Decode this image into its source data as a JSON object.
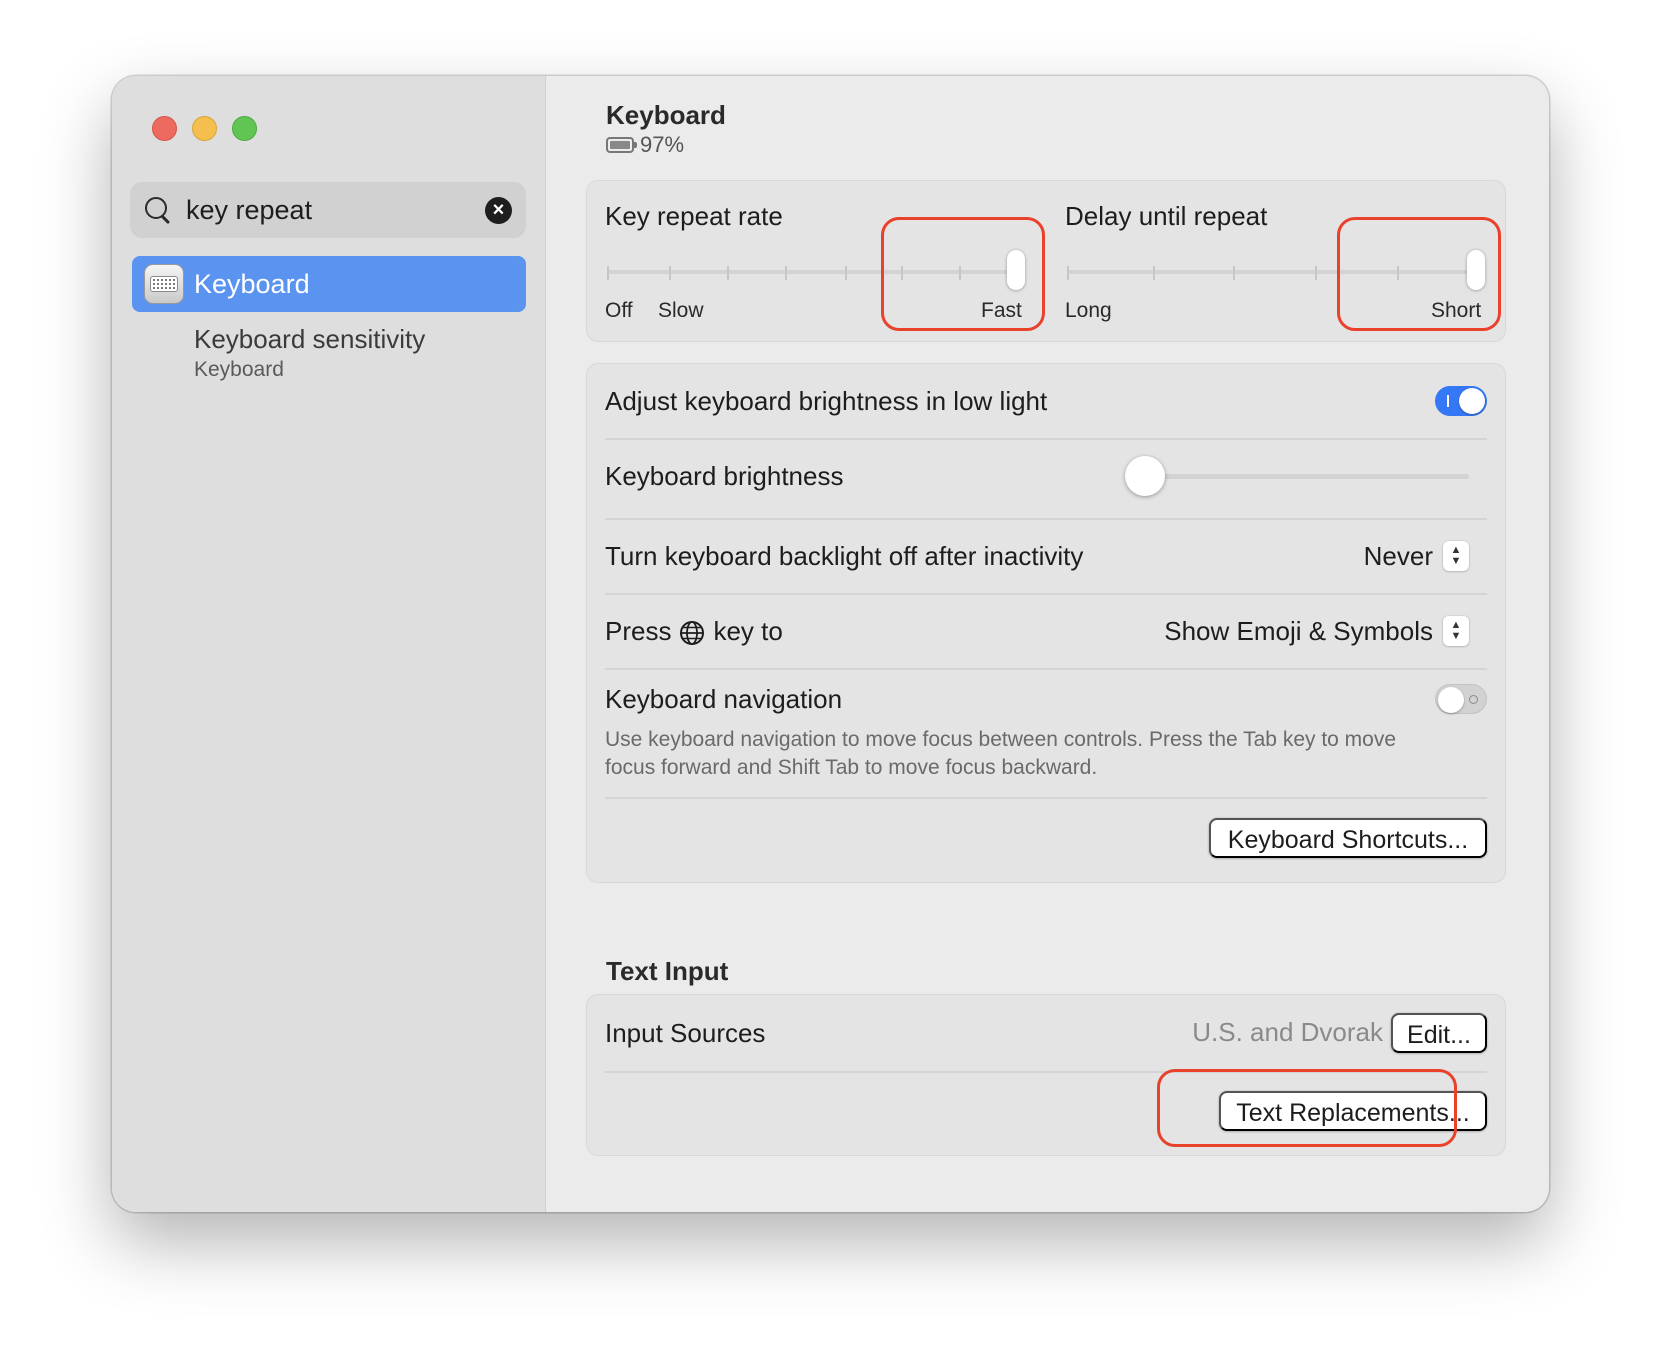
{
  "sidebar": {
    "search": {
      "value": "key repeat"
    },
    "selected_item": {
      "label": "Keyboard",
      "icon": "keyboard-icon"
    },
    "result": {
      "title": "Keyboard sensitivity",
      "subtitle": "Keyboard"
    }
  },
  "header": {
    "title": "Keyboard",
    "battery": "97%"
  },
  "key_repeat": {
    "rate": {
      "label": "Key repeat rate",
      "tick_labels": [
        "Off",
        "Slow",
        "Fast"
      ],
      "ticks": 8,
      "value_step": 7
    },
    "delay": {
      "label": "Delay until repeat",
      "tick_labels": [
        "Long",
        "Short"
      ],
      "ticks": 6,
      "value_step": 5
    }
  },
  "settings": {
    "adjust_brightness": {
      "label": "Adjust keyboard brightness in low light",
      "on": true
    },
    "brightness": {
      "label": "Keyboard brightness",
      "value": 0
    },
    "backlight_off": {
      "label": "Turn keyboard backlight off after inactivity",
      "value": "Never"
    },
    "press_key": {
      "label_before": "Press",
      "label_after": "key to",
      "value": "Show Emoji & Symbols"
    },
    "keyboard_navigation": {
      "label": "Keyboard navigation",
      "description": "Use keyboard navigation to move focus between controls. Press the Tab key to move focus forward and Shift Tab to move focus backward.",
      "on": false
    },
    "shortcuts_button": "Keyboard Shortcuts..."
  },
  "text_input": {
    "section_title": "Text Input",
    "input_sources": {
      "label": "Input Sources",
      "value": "U.S. and Dvorak",
      "edit_button": "Edit..."
    },
    "text_replacements_button": "Text Replacements..."
  },
  "colors": {
    "accent": "#3478f6",
    "selection": "#5b93f1",
    "annotation": "#e8412c"
  }
}
